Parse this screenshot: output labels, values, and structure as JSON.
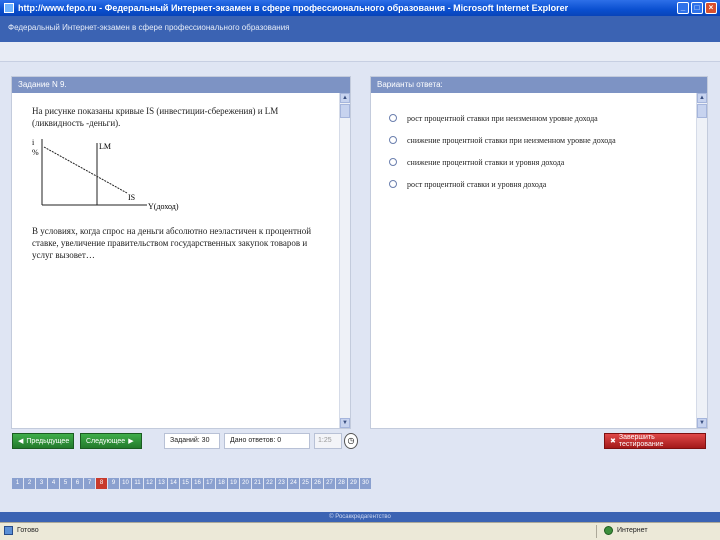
{
  "window": {
    "title": "http://www.fepo.ru - Федеральный Интернет-экзамен в сфере профессионального образования - Microsoft Internet Explorer",
    "minimize": "_",
    "maximize": "□",
    "close": "×"
  },
  "header": {
    "site_title": "Федеральный Интернет-экзамен в сфере профессионального образования"
  },
  "question": {
    "heading": "Задание N 9.",
    "text_top": "На рисунке показаны кривые IS (инвестиции-сбережения) и LM (ликвидность -деньги).",
    "text_bottom": "В условиях, когда спрос на деньги абсолютно неэластичен к процентной ставке, увеличение правительством государственных закупок товаров и услуг вызовет…",
    "graph": {
      "y_label": "i",
      "y_unit": "%",
      "lm_label": "LM",
      "is_label": "IS",
      "x_label": "Y(доход)"
    }
  },
  "answers": {
    "heading": "Варианты ответа:",
    "options": [
      "рост процентной ставки при неизменном уровне дохода",
      "снижение процентной ставки при неизменном уровне дохода",
      "снижение процентной ставки и уровня дохода",
      "рост процентной ставки и уровня дохода"
    ]
  },
  "nav": {
    "prev_label": "Предыдущее",
    "next_label": "Следующее",
    "total_label": "Заданий: 30",
    "answered_label": "Дано ответов: 0",
    "timer": "1:25",
    "finish_label": "Завершить тестирование"
  },
  "pager": {
    "pages": [
      "1",
      "2",
      "3",
      "4",
      "5",
      "6",
      "7",
      "8",
      "9",
      "10",
      "11",
      "12",
      "13",
      "14",
      "15",
      "16",
      "17",
      "18",
      "19",
      "20",
      "21",
      "22",
      "23",
      "24",
      "25",
      "26",
      "27",
      "28",
      "29",
      "30"
    ],
    "current": 8
  },
  "footer": {
    "text": "© Росаккредагентство"
  },
  "status": {
    "left": "Готово",
    "right": "Интернет"
  }
}
